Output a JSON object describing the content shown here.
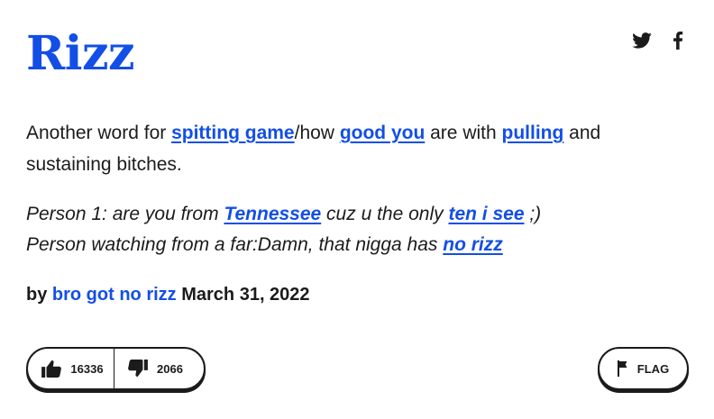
{
  "word": "Rizz",
  "social": {
    "twitter_icon": "twitter-bird-icon",
    "facebook_icon": "facebook-f-icon"
  },
  "meaning": {
    "t1": "Another word for ",
    "link1": "spitting game",
    "t2": "/how ",
    "link2": "good you",
    "t3": " are with ",
    "link3": "pulling",
    "t4": " and sustaining bitches."
  },
  "example": {
    "l1a": "Person 1: are you from ",
    "l1link1": "Tennessee",
    "l1b": " cuz u the only ",
    "l1link2": "ten i see",
    "l1c": " ;)",
    "l2a": "Person watching from a far:Damn, that nigga has ",
    "l2link": "no rizz"
  },
  "contributor": {
    "by": "by ",
    "author": "bro got no rizz",
    "date": " March 31, 2022"
  },
  "votes": {
    "up_count": "16336",
    "down_count": "2066"
  },
  "flag": {
    "label": "FLAG"
  },
  "colors": {
    "link": "#134fe6",
    "text": "#1b1b1b"
  }
}
